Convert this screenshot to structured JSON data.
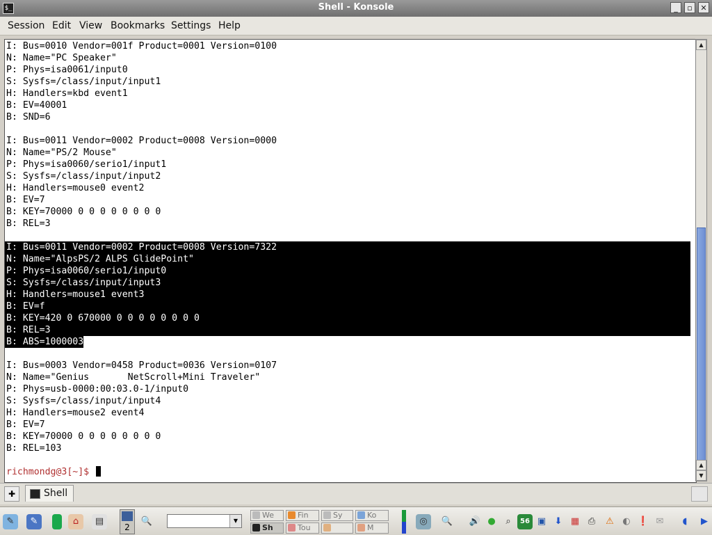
{
  "window": {
    "title": "Shell - Konsole",
    "app_icon": "terminal-icon"
  },
  "menu": [
    "Session",
    "Edit",
    "View",
    "Bookmarks",
    "Settings",
    "Help"
  ],
  "terminal": {
    "lines": [
      "I: Bus=0010 Vendor=001f Product=0001 Version=0100",
      "N: Name=\"PC Speaker\"",
      "P: Phys=isa0061/input0",
      "S: Sysfs=/class/input/input1",
      "H: Handlers=kbd event1",
      "B: EV=40001",
      "B: SND=6",
      "",
      "I: Bus=0011 Vendor=0002 Product=0008 Version=0000",
      "N: Name=\"PS/2 Mouse\"",
      "P: Phys=isa0060/serio1/input1",
      "S: Sysfs=/class/input/input2",
      "H: Handlers=mouse0 event2",
      "B: EV=7",
      "B: KEY=70000 0 0 0 0 0 0 0 0",
      "B: REL=3",
      "",
      "I: Bus=0011 Vendor=0002 Product=0008 Version=7322",
      "N: Name=\"AlpsPS/2 ALPS GlidePoint\"",
      "P: Phys=isa0060/serio1/input0",
      "S: Sysfs=/class/input/input3",
      "H: Handlers=mouse1 event3",
      "B: EV=f",
      "B: KEY=420 0 670000 0 0 0 0 0 0 0 0",
      "B: REL=3",
      "B: ABS=1000003",
      "",
      "I: Bus=0003 Vendor=0458 Product=0036 Version=0107",
      "N: Name=\"Genius       NetScroll+Mini Traveler\"",
      "P: Phys=usb-0000:00:03.0-1/input0",
      "S: Sysfs=/class/input/input4",
      "H: Handlers=mouse2 event4",
      "B: EV=7",
      "B: KEY=70000 0 0 0 0 0 0 0 0",
      "B: REL=103",
      "",
      "richmondg@3[~]$ "
    ],
    "prompt": "richmondg@3[~]$ "
  },
  "tabs": [
    {
      "label": "Shell",
      "icon": "terminal-icon"
    }
  ],
  "panel": {
    "desktop_number": "2",
    "taskbar_items": [
      "We",
      "Fin",
      "Sy",
      "Ko",
      "Sh",
      "Tou",
      "",
      "M"
    ]
  }
}
